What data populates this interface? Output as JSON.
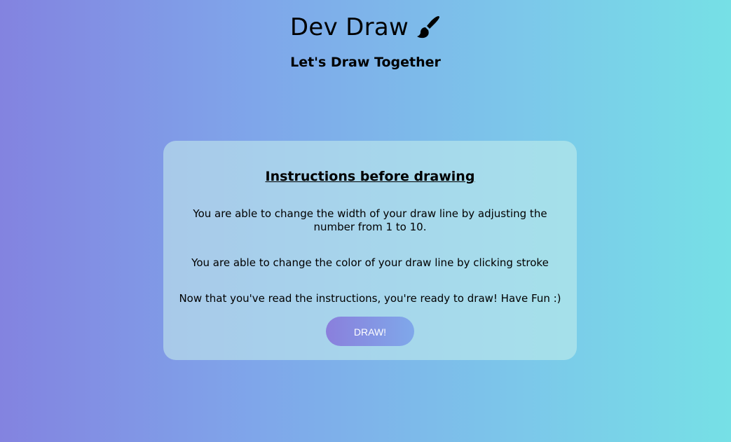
{
  "header": {
    "title": "Dev Draw",
    "title_icon": "paintbrush-icon",
    "subtitle": "Let's Draw Together"
  },
  "card": {
    "heading": "Instructions before drawing",
    "paragraphs": [
      "You are able to change the width of your draw line by adjusting the number from 1 to 10.",
      "You are able to change the color of your draw line by clicking stroke",
      "Now that you've read the instructions, you're ready to draw! Have Fun :)"
    ],
    "button_label": "DRAW!"
  },
  "colors": {
    "background_start": "#8383e0",
    "background_end": "#76e0e6",
    "button_start": "#8a7fdc",
    "button_end": "#7fa8ea",
    "button_text": "#ffffff"
  }
}
